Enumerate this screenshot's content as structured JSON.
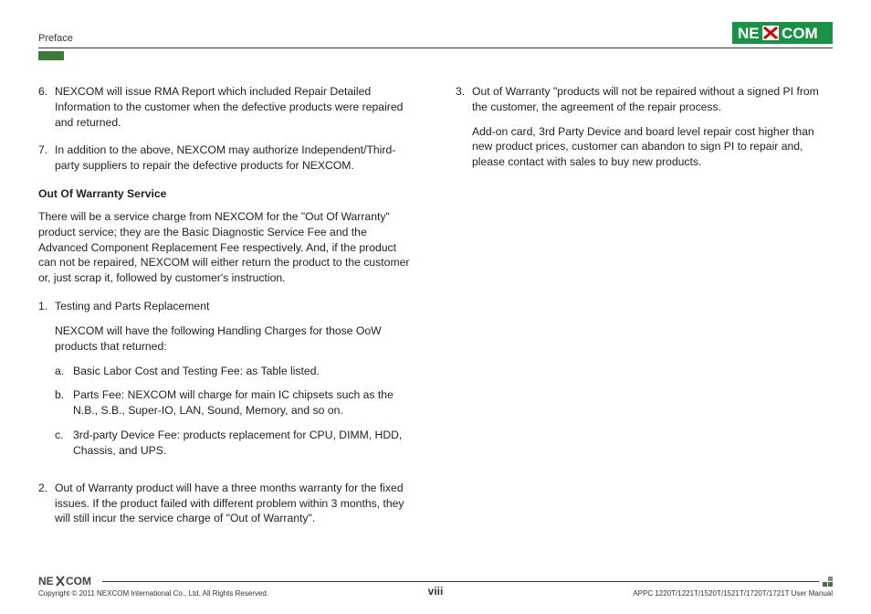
{
  "header": {
    "section": "Preface",
    "brand": "NEXCOM"
  },
  "left_col": {
    "continued_list": [
      {
        "num": "6.",
        "text": "NEXCOM will issue RMA Report which included Repair Detailed Information to the customer when the defective products were repaired and returned."
      },
      {
        "num": "7.",
        "text": "In addition to the above, NEXCOM may authorize Independent/Third-party suppliers to repair the defective products for NEXCOM."
      }
    ],
    "subheading": "Out Of Warranty Service",
    "intro": "There will be a service charge from NEXCOM for the \"Out Of Warranty\" product service; they are the Basic Diagnostic Service Fee and the Advanced Component Replacement Fee respectively. And, if the product can not be repaired, NEXCOM will either return the product to the customer or, just scrap it, followed by customer's instruction.",
    "oow_list": [
      {
        "num": "1.",
        "text": "Testing and Parts Replacement",
        "inner": "NEXCOM will have the following Handling Charges for those OoW products that returned:",
        "sub": [
          {
            "lbl": "a.",
            "text": "Basic Labor Cost and Testing Fee: as Table listed."
          },
          {
            "lbl": "b.",
            "text": "Parts Fee: NEXCOM will charge for main IC chipsets such as the N.B., S.B., Super-IO, LAN, Sound, Memory, and so on."
          },
          {
            "lbl": "c.",
            "text": "3rd-party Device Fee: products replacement for CPU, DIMM, HDD, Chassis, and UPS."
          }
        ]
      },
      {
        "num": "2.",
        "text": "Out of Warranty product will have a three months warranty for the fixed issues. If the product failed with different problem within 3 months, they will still incur the service charge of \"Out of Warranty\"."
      }
    ]
  },
  "right_col": {
    "list": [
      {
        "num": "3.",
        "text": "Out of Warranty \"products will not be repaired without a signed PI from the customer, the agreement of the repair process.",
        "inner": "Add-on card, 3rd Party Device and board level repair cost higher than new product prices, customer can abandon to sign PI to repair and, please contact with sales to buy new products."
      }
    ]
  },
  "footer": {
    "copyright": "Copyright © 2011 NEXCOM International Co., Ltd. All Rights Reserved.",
    "page_num": "viii",
    "doc_ref": "APPC 1220T/1221T/1520T/1521T/1720T/1721T User Manual"
  }
}
